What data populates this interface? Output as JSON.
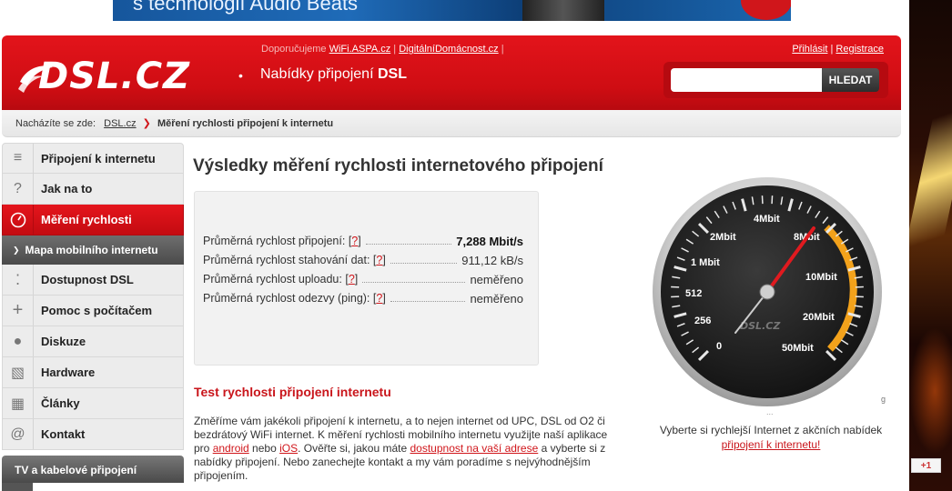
{
  "ad": {
    "top_text": "s technologií Audio Beats"
  },
  "header": {
    "logo_text": "DSL.CZ",
    "dot": "•",
    "tagline_prefix": "Nabídky připojení ",
    "tagline_bold": "DSL",
    "recommend_prefix": "Doporučujeme",
    "recommend_links": [
      "WiFi.ASPA.cz",
      "DigitálníDomácnost.cz"
    ],
    "login": "Přihlásit",
    "register": "Registrace",
    "search_placeholder": "",
    "search_button": "HLEDAT"
  },
  "breadcrumb": {
    "prefix": "Nacházíte se zde:",
    "home": "DSL.cz",
    "current": "Měření rychlosti připojení k internetu"
  },
  "sidebar": {
    "items": [
      {
        "label": "Připojení k internetu",
        "icon": "list-icon"
      },
      {
        "label": "Jak na to",
        "icon": "question-icon"
      },
      {
        "label": "Měření rychlosti",
        "icon": "gauge-icon"
      },
      {
        "label": "Mapa mobilního internetu",
        "icon": "arrow-right-icon"
      },
      {
        "label": "Dostupnost DSL",
        "icon": "dots-icon"
      },
      {
        "label": "Pomoc s počítačem",
        "icon": "plus-icon"
      },
      {
        "label": "Diskuze",
        "icon": "chat-icon"
      },
      {
        "label": "Hardware",
        "icon": "hardware-icon"
      },
      {
        "label": "Články",
        "icon": "book-icon"
      },
      {
        "label": "Kontakt",
        "icon": "at-icon"
      }
    ],
    "category": "TV a kabelové připojení"
  },
  "main": {
    "title": "Výsledky měření rychlosti internetového připojení",
    "q_link": "?",
    "results": [
      {
        "label": "Průměrná rychlost připojení:",
        "value": "7,288 Mbit/s"
      },
      {
        "label": "Průměrná rychlost stahování dat:",
        "value": "911,12 kB/s"
      },
      {
        "label": "Průměrná rychlost uploadu:",
        "value": "neměřeno"
      },
      {
        "label": "Průměrná rychlost odezvy (ping):",
        "value": "neměřeno"
      }
    ],
    "test_title": "Test rychlosti připojení internetu",
    "desc": {
      "p1": "Změříme vám jakékoli připojení k internetu, a to nejen internet od UPC, DSL od O2 či bezdrátový WiFi internet. K měření rychlosti mobilního internetu využijte naší aplikace pro ",
      "android": "android",
      "p2": " nebo ",
      "ios": "iOS",
      "p3": ". Ověřte si, jakou máte ",
      "dostupnost": "dostupnost na vaší adrese",
      "p4": " a vyberte si z nabídky připojení. Nebo zanechejte kontakt a my vám poradíme s nejvýhodnějším připojením."
    }
  },
  "gauge": {
    "labels": [
      "0",
      "256",
      "512",
      "1 Mbit",
      "2Mbit",
      "4Mbit",
      "8Mbit",
      "10Mbit",
      "20Mbit",
      "50Mbit"
    ],
    "watermark": "DSL.CZ",
    "needle_value": "7,288 Mbit/s",
    "caption": "Vyberte si rychlejší Internet z akčních nabídek",
    "caption_link": "připojení k internetu!",
    "dots": "...",
    "q": "g"
  },
  "gplus": "+1",
  "colors": {
    "brand": "#d0161b",
    "text": "#333333"
  }
}
